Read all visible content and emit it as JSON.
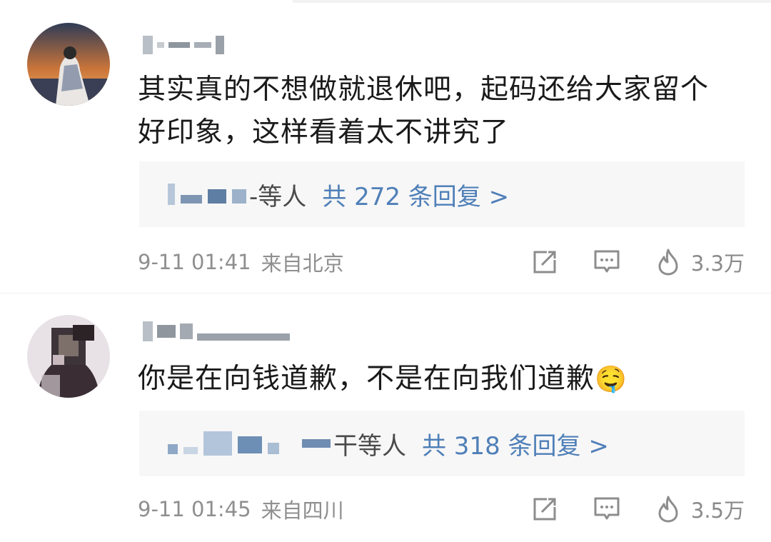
{
  "comments": [
    {
      "text_line1": "其实真的不想做就退休吧，起码还给大家留个",
      "text_line2": "好印象，这样看着太不讲究了",
      "reply_suffix": "-等人",
      "reply_link": "共 272 条回复 >",
      "time": "9-11 01:41",
      "location": "来自北京",
      "likes": "3.3万"
    },
    {
      "text_line1": "你是在向钱道歉，不是在向我们道歉",
      "emoji": "🤤",
      "reply_suffix": "干等人",
      "reply_link": "共 318 条回复 >",
      "time": "9-11 01:45",
      "location": "来自四川",
      "likes": "3.5万"
    }
  ],
  "icons": {
    "share": "share-icon",
    "comment": "comment-icon",
    "like": "fire-like-icon"
  },
  "colors": {
    "link": "#4f7fb8",
    "reply_bg": "#f7f7f7",
    "meta_text": "#8f8f8f"
  }
}
